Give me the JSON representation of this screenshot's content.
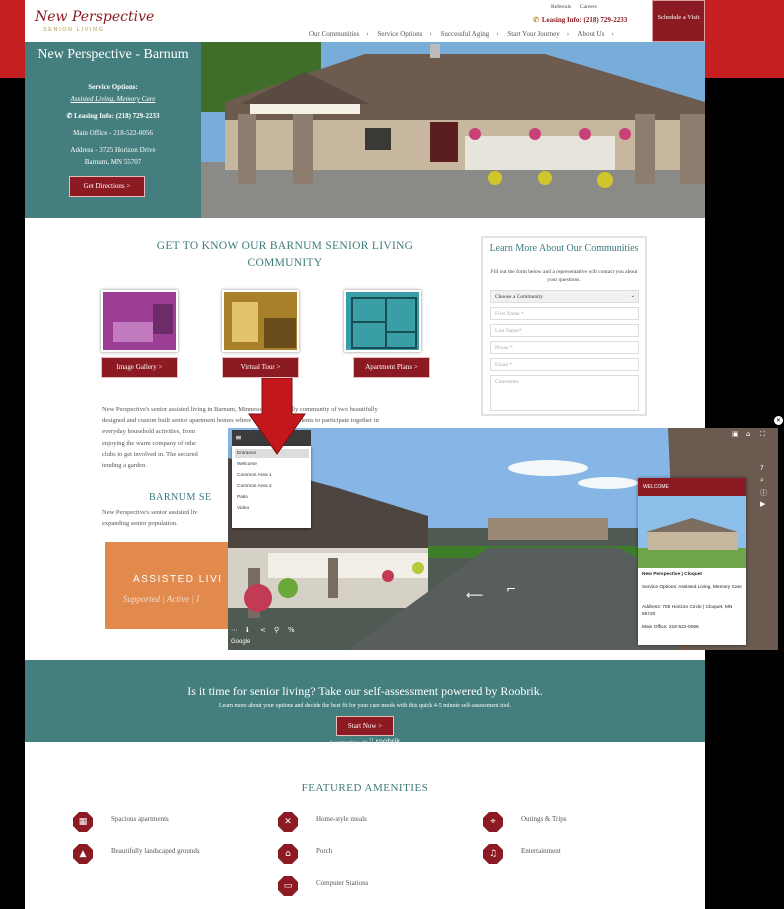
{
  "header": {
    "logo_text": "New Perspective",
    "logo_sub": "SENIOR LIVING",
    "util_links": [
      "Referrals",
      "Careers"
    ],
    "leasing": "Leasing Info: (218) 729-2233",
    "nav": [
      "Our Communities",
      "Service Options",
      "Successful Aging",
      "Start Your Journey",
      "About Us"
    ],
    "schedule_button": "Schedule a Visit"
  },
  "hero_panel": {
    "title": "New Perspective - Barnum",
    "service_label": "Service Options:",
    "service_value": "Assisted Living, Memory Care",
    "leasing": "Leasing Info: (218) 729-2233",
    "main_office": "Main Office - 218-522-0056",
    "address_line1": "Address - 3725 Horizon Drive",
    "address_line2": "Barnum, MN 55707",
    "directions_button": "Get Directions >"
  },
  "content": {
    "heading": "GET TO KNOW OUR BARNUM SENIOR LIVING COMMUNITY",
    "thumb_buttons": [
      "Image Gallery >",
      "Virtual Tour >",
      "Apartment Plans >"
    ],
    "para1_lines": [
      "New Perspective's senior assisted living in Barnum, Minnesota is a friendly community of two beautifully",
      "designed and custom built senior apartment homes where we encourage residents to participate together in",
      "everyday household activities, from",
      "enjoying the warm company of othe",
      "clubs to get involved in. The secured",
      "tending a garden."
    ],
    "subheading": "BARNUM SE",
    "para2_lines": [
      "New Perspective's senior assisted liv",
      "expanding senior population."
    ],
    "card_title": "ASSISTED LIVI",
    "card_subtitle": "Supported | Active | I"
  },
  "form": {
    "title": "Learn More About Our Communities",
    "subtitle": "Fill out the form below and a representative will contact you about your questions.",
    "select_value": "Choose a Community",
    "placeholders": [
      "First Name *",
      "Last Name*",
      "Phone *",
      "Email *",
      "Comments"
    ]
  },
  "banner": {
    "heading": "Is it time for senior living? Take our self-assessment powered by Roobrik.",
    "sub": "Learn more about your options and decide the best fit for your care needs with this quick 4-5 minute self-assessment tool.",
    "button": "Start Now >",
    "partner_prefix": "In partnership with",
    "partner_name": "roobrik"
  },
  "amenities": {
    "title": "FEATURED AMENITIES",
    "items": [
      {
        "label": "Spacious apartments",
        "icon": "apartment-icon"
      },
      {
        "label": "Home-style meals",
        "icon": "meals-icon"
      },
      {
        "label": "Outings & Trips",
        "icon": "outings-icon"
      },
      {
        "label": "Beautifully landscaped grounds",
        "icon": "landscape-icon"
      },
      {
        "label": "Porch",
        "icon": "porch-icon"
      },
      {
        "label": "Entertainment",
        "icon": "entertainment-icon"
      },
      {
        "label": "Computer Stations",
        "icon": "computer-icon"
      }
    ]
  },
  "virtual_tour": {
    "menu_items": [
      "Entrance",
      "Welcome",
      "Common Area 1",
      "Common Area 2",
      "Patio",
      "Video"
    ],
    "card_header": "WELCOME",
    "card_title": "New Perspective | Cloquet",
    "card_service": "Service Options: Assisted Living, Memory Care",
    "card_address": "Address: 705 Horizon Circle | Cloquet, MN 55720",
    "card_office": "Main Office: 218-522-0056",
    "google": "Google"
  },
  "colors": {
    "brand_red": "#8c1a22",
    "teal": "#457e7e",
    "top_band_red": "#c61f22",
    "arrow_red": "#c3171b"
  }
}
